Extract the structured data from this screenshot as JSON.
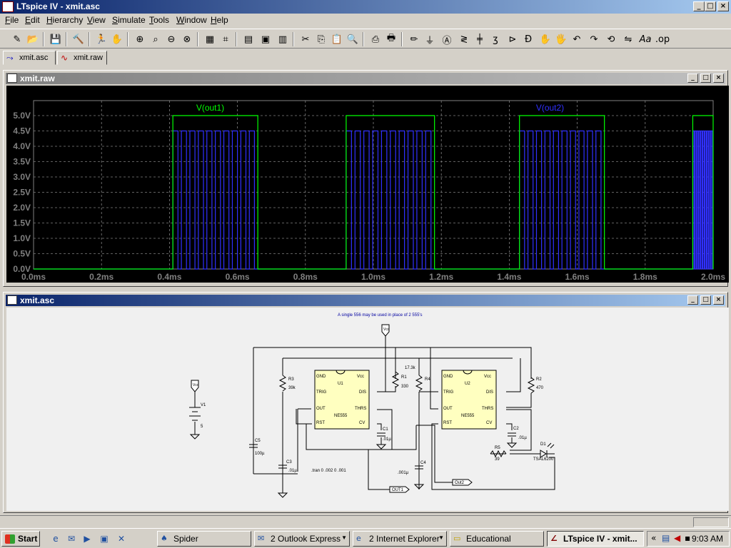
{
  "window": {
    "title": "LTspice IV - xmit.asc"
  },
  "menu": [
    {
      "underline": "F",
      "rest": "ile"
    },
    {
      "underline": "E",
      "rest": "dit"
    },
    {
      "underline": "H",
      "rest": "ierarchy"
    },
    {
      "underline": "V",
      "rest": "iew"
    },
    {
      "underline": "S",
      "rest": "imulate"
    },
    {
      "underline": "T",
      "rest": "ools"
    },
    {
      "underline": "W",
      "rest": "indow"
    },
    {
      "underline": "H",
      "rest": "elp"
    }
  ],
  "tabs": {
    "schematic": "xmit.asc",
    "waveform": "xmit.raw"
  },
  "plot_window": {
    "title": "xmit.raw"
  },
  "schematic_window": {
    "title": "xmit.asc"
  },
  "chart_data": {
    "type": "line",
    "traces": [
      {
        "name": "V(out1)",
        "color": "#00ff00",
        "high_intervals": [
          [
            0.41,
            0.66
          ],
          [
            0.92,
            1.18
          ],
          [
            1.43,
            1.68
          ],
          [
            1.94,
            2.0
          ]
        ],
        "high_value": 5.0
      },
      {
        "name": "V(out2)",
        "color": "#3030ff",
        "burst_intervals": [
          [
            0.41,
            0.66
          ],
          [
            0.92,
            1.18
          ],
          [
            1.43,
            1.68
          ],
          [
            1.94,
            2.0
          ]
        ],
        "burst_pulses": 10,
        "high_value": 4.5
      }
    ],
    "x_ticks": [
      "0.0ms",
      "0.2ms",
      "0.4ms",
      "0.6ms",
      "0.8ms",
      "1.0ms",
      "1.2ms",
      "1.4ms",
      "1.6ms",
      "1.8ms",
      "2.0ms"
    ],
    "y_ticks": [
      "5.0V",
      "4.5V",
      "4.0V",
      "3.5V",
      "3.0V",
      "2.5V",
      "2.0V",
      "1.5V",
      "1.0V",
      "0.5V",
      "0.0V"
    ],
    "xlim": [
      0,
      2.0
    ],
    "ylim": [
      0,
      5.0
    ],
    "grid": true
  },
  "schematic": {
    "note": "A single 556 may be used in place of 2 555's",
    "components": {
      "u1": {
        "ref": "U1",
        "part": "NE555",
        "pins": [
          "GND",
          "Vcc",
          "TRIG",
          "DIS",
          "OUT",
          "THRS",
          "RST",
          "CV"
        ]
      },
      "u2": {
        "ref": "U2",
        "part": "NE555",
        "pins": [
          "GND",
          "Vcc",
          "TRIG",
          "DIS",
          "OUT",
          "THRS",
          "RST",
          "CV"
        ]
      },
      "r1": {
        "ref": "R1",
        "value": "330"
      },
      "r2": {
        "ref": "R2",
        "value": "470"
      },
      "r3": {
        "ref": "R3",
        "value": "39k"
      },
      "r4": {
        "ref": "R4",
        "value": "17.3k"
      },
      "r5": {
        "ref": "R5",
        "value": "39"
      },
      "c1": {
        "ref": "C1",
        "value": ".01µ"
      },
      "c2": {
        "ref": "C2",
        "value": ".01µ"
      },
      "c3": {
        "ref": "C3",
        "value": ".01µ"
      },
      "c4": {
        "ref": "C4",
        "value": ".001µ"
      },
      "c5": {
        "ref": "C5",
        "value": "100µ"
      },
      "v1": {
        "ref": "V1",
        "value": "5"
      },
      "d1": {
        "ref": "D1",
        "value": "TSAL6200"
      }
    },
    "labels": {
      "vcc": "Vcc",
      "out1": "OUT1",
      "out2": "Out2",
      "tran": ".tran 0 .002 0 .001"
    }
  },
  "taskbar": {
    "start": "Start",
    "tasks": [
      "Spider",
      "2 Outlook Express",
      "2 Internet Explorer",
      "Educational",
      "LTspice IV - xmit..."
    ],
    "clock": "9:03 AM"
  }
}
